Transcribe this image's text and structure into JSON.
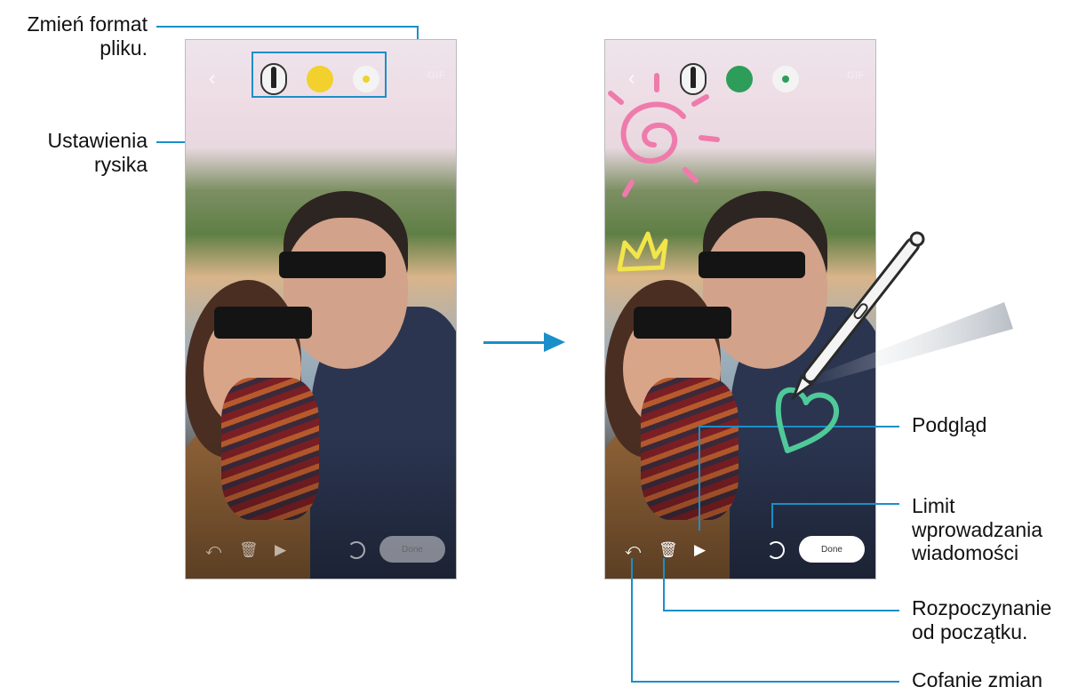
{
  "callouts": {
    "change_format": "Zmień format pliku.",
    "pen_settings": "Ustawienia rysika",
    "preview": "Podgląd",
    "limit": "Limit wprowadzania wiadomości",
    "start_over": "Rozpoczynanie od początku.",
    "undo": "Cofanie zmian"
  },
  "screens": [
    {
      "top_toolbar": {
        "back_icon": "chevron-left-icon",
        "pen_icon": "pen-icon",
        "color": "#f2d02e",
        "pen_size_dot_color": "#f2d02e",
        "format_label": "GIF"
      },
      "bottom_toolbar": {
        "undo_icon": "undo-icon",
        "trash_icon": "trash-icon",
        "play_icon": "play-icon",
        "timer_icon": "timer-icon",
        "done_label": "Done"
      }
    },
    {
      "top_toolbar": {
        "back_icon": "chevron-left-icon",
        "pen_icon": "pen-icon",
        "color": "#2e9d5a",
        "pen_size_dot_color": "#2e9d5a",
        "format_label": "GIF"
      },
      "bottom_toolbar": {
        "undo_icon": "undo-icon",
        "trash_icon": "trash-icon",
        "play_icon": "play-icon",
        "timer_icon": "timer-icon",
        "done_label": "Done"
      }
    }
  ]
}
